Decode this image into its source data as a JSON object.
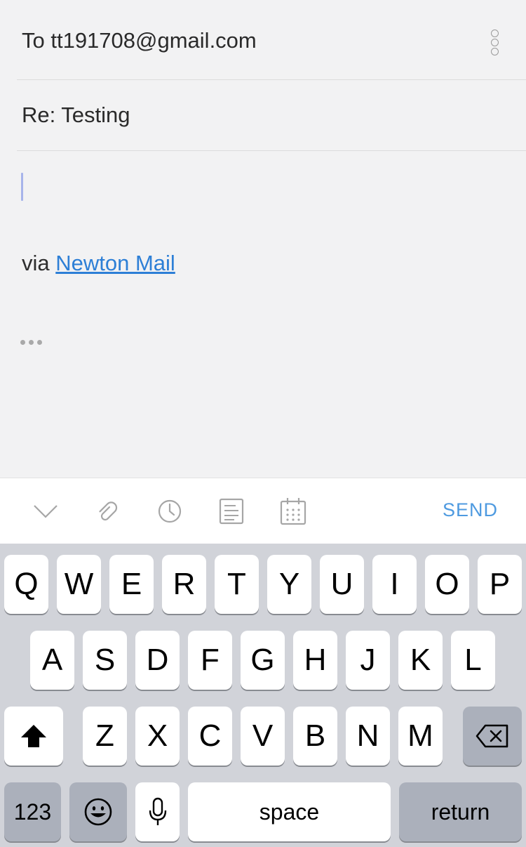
{
  "compose": {
    "to_text": "To tt191708@gmail.com",
    "subject": "Re: Testing",
    "signature_prefix": "via ",
    "signature_link": "Newton Mail"
  },
  "toolbar": {
    "send_label": "SEND",
    "icons": [
      "chevron-down-icon",
      "paperclip-icon",
      "clock-icon",
      "template-icon",
      "calendar-icon"
    ]
  },
  "keyboard": {
    "row1": [
      "Q",
      "W",
      "E",
      "R",
      "T",
      "Y",
      "U",
      "I",
      "O",
      "P"
    ],
    "row2": [
      "A",
      "S",
      "D",
      "F",
      "G",
      "H",
      "J",
      "K",
      "L"
    ],
    "row3": [
      "Z",
      "X",
      "C",
      "V",
      "B",
      "N",
      "M"
    ],
    "numbers_label": "123",
    "space_label": "space",
    "return_label": "return"
  }
}
